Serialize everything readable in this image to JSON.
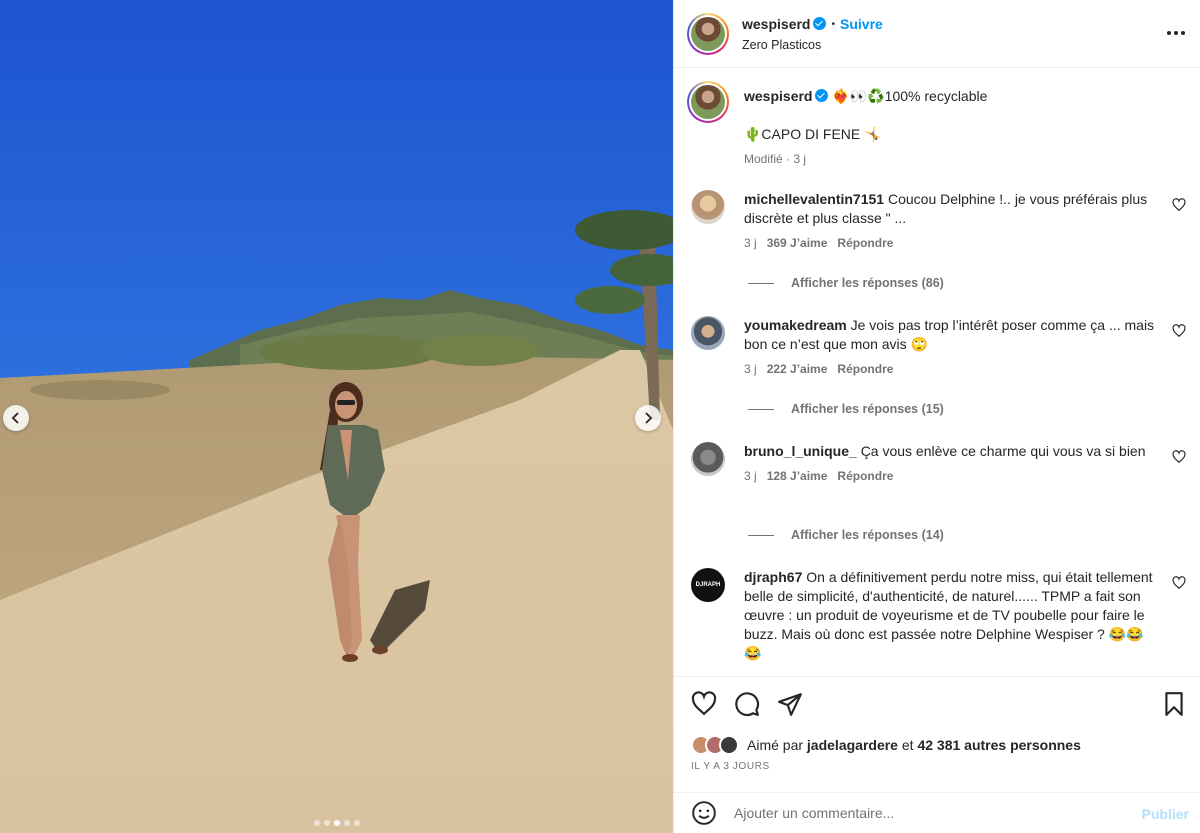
{
  "header": {
    "username": "wespiserd",
    "separator": "•",
    "follow_label": "Suivre",
    "subtitle": "Zero Plasticos",
    "more_icon": "more-horizontal-icon"
  },
  "media": {
    "total_slides": 5,
    "active_slide": 3,
    "prev_icon": "chevron-left-icon",
    "next_icon": "chevron-right-icon"
  },
  "caption": {
    "username": "wespiserd",
    "line1": "❤️‍🔥👀♻️100% recyclable",
    "line2": "🌵CAPO DI FENE 🤸",
    "meta": "Modifié · 3 j"
  },
  "comments": [
    {
      "username": "michellevalentin7151",
      "text": "Coucou Delphine !.. je vous préférais plus discrète et plus classe \" ...",
      "age": "3 j",
      "likes": "369 J’aime",
      "reply_label": "Répondre",
      "replies_label": "Afficher les réponses (86)"
    },
    {
      "username": "youmakedream",
      "text": "Je vois pas trop l’intérêt poser comme ça ... mais bon ce n’est que mon avis 🙄",
      "age": "3 j",
      "likes": "222 J’aime",
      "reply_label": "Répondre",
      "replies_label": "Afficher les réponses (15)"
    },
    {
      "username": "bruno_l_unique_",
      "text": "Ça vous enlève ce charme qui vous va si bien",
      "age": "3 j",
      "likes": "128 J’aime",
      "reply_label": "Répondre",
      "replies_label": "Afficher les réponses (14)"
    },
    {
      "username": "djraph67",
      "text": "On a définitivement perdu notre miss, qui était tellement belle de simplicité, d'authenticité, de naturel...... TPMP a fait son œuvre : un produit de voyeurisme et de TV poubelle pour faire le buzz. Mais où donc est passée notre Delphine Wespiser ? 😂😂😂",
      "avatar_text": "DJRAPH"
    }
  ],
  "actions": {
    "like_icon": "heart-icon",
    "comment_icon": "comment-icon",
    "share_icon": "send-icon",
    "save_icon": "bookmark-icon",
    "liked_by_prefix": "Aimé par",
    "liked_by_user": "jadelagardere",
    "liked_by_and": "et",
    "liked_by_others": "42 381 autres personnes",
    "time": "IL Y A 3 JOURS"
  },
  "add_comment": {
    "emoji_icon": "emoji-icon",
    "placeholder": "Ajouter un commentaire...",
    "publish_label": "Publier"
  },
  "colors": {
    "accent": "#0095f6",
    "text": "#262626",
    "secondary": "#737373",
    "publish_disabled": "#b2dffc"
  }
}
